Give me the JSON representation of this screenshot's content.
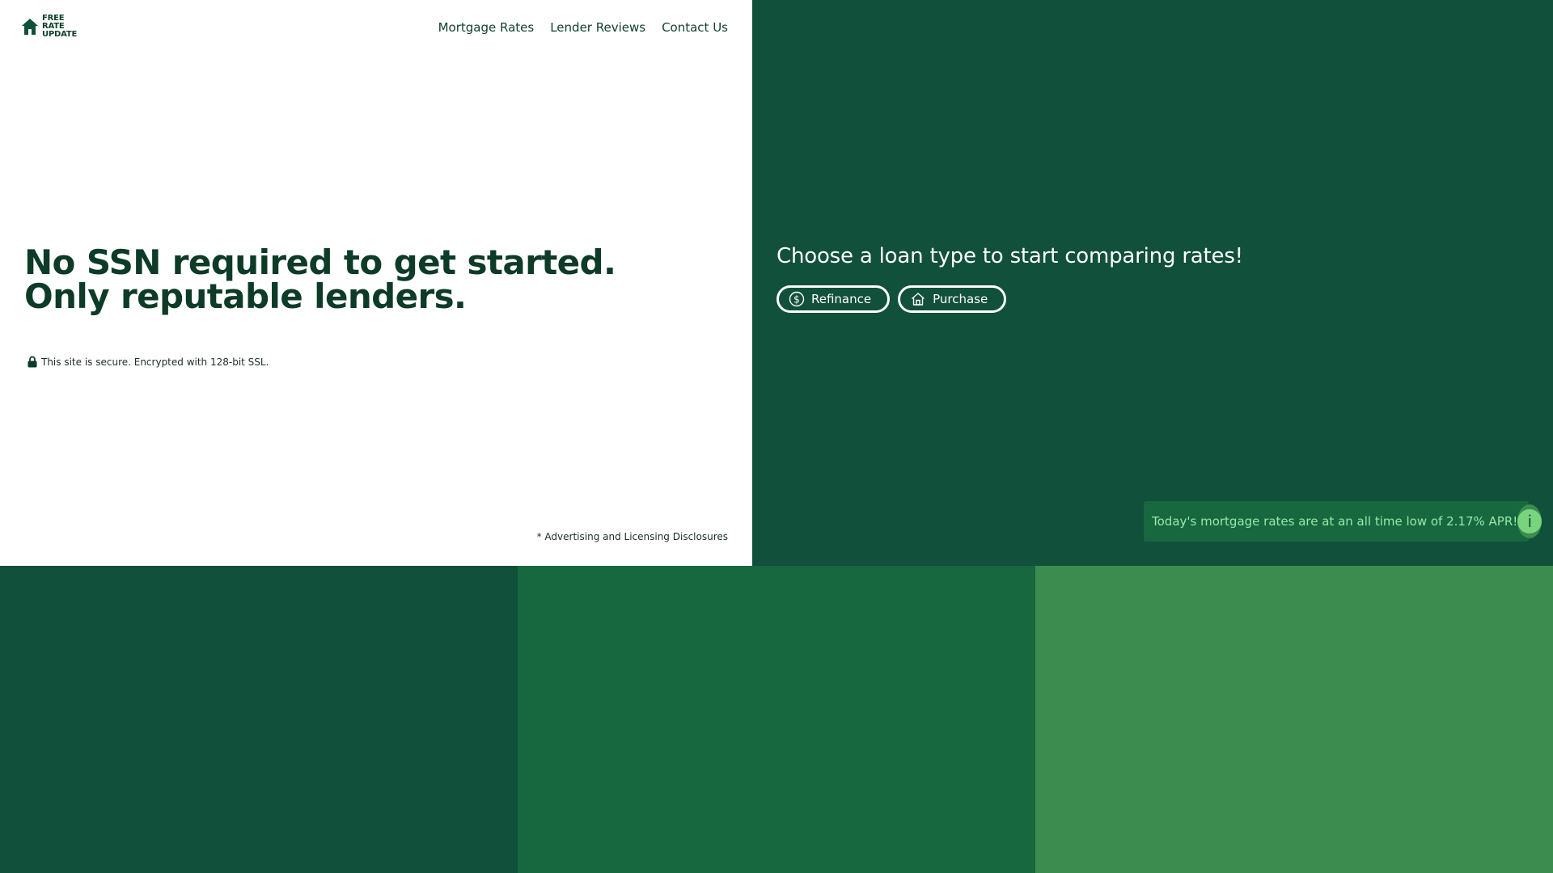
{
  "logo": {
    "lines": [
      "FREE",
      "RATE",
      "UPDATE"
    ]
  },
  "nav": {
    "items": [
      "Mortgage Rates",
      "Lender Reviews",
      "Contact Us"
    ]
  },
  "hero": {
    "line1": "No SSN required to get started.",
    "line2": "Only reputable lenders."
  },
  "secure": {
    "text": "This site is secure. Encrypted with 128-bit SSL."
  },
  "disclosures": {
    "text": "* Advertising and Licensing Disclosures"
  },
  "loan": {
    "heading": "Choose a loan type to start comparing rates!",
    "buttons": [
      {
        "label": "Refinance",
        "icon": "dollar-circle-icon"
      },
      {
        "label": "Purchase",
        "icon": "house-icon"
      }
    ]
  },
  "banner": {
    "text": "Today's mortgage rates are at an all time low of 2.17% APR!",
    "icon": "info-icon"
  },
  "colors": {
    "dark_green": "#11503a",
    "mid_green": "#17683f",
    "light_green": "#3c8c50",
    "heading_text": "#0d3b28",
    "banner_text": "#9ae6a9"
  }
}
